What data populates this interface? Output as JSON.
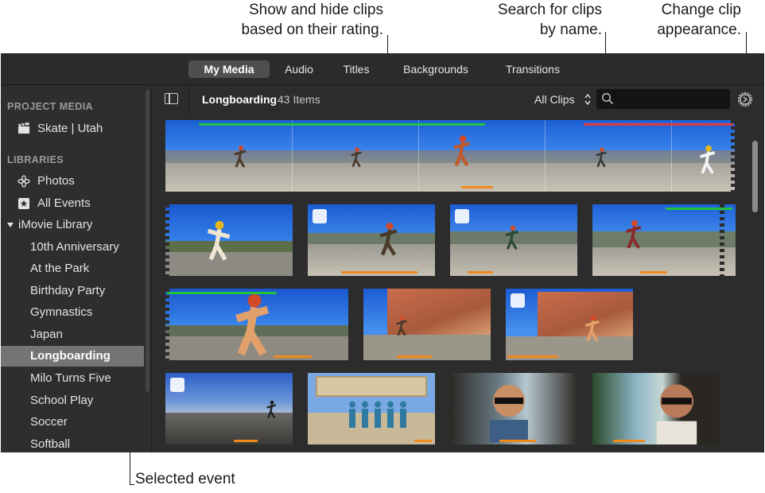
{
  "callouts": {
    "rating": "Show and hide clips\nbased on their rating.",
    "rating_line1": "Show and hide clips",
    "rating_line2": "based on their rating.",
    "search_line1": "Search for clips",
    "search_line2": "by name.",
    "appearance_line1": "Change clip",
    "appearance_line2": "appearance.",
    "selected": "Selected event"
  },
  "tabs": [
    {
      "label": "My Media",
      "active": true
    },
    {
      "label": "Audio",
      "active": false
    },
    {
      "label": "Titles",
      "active": false
    },
    {
      "label": "Backgrounds",
      "active": false
    },
    {
      "label": "Transitions",
      "active": false
    }
  ],
  "sidebar": {
    "project_media_heading": "PROJECT MEDIA",
    "project": {
      "label": "Skate | Utah",
      "icon": "clapperboard-icon"
    },
    "libraries_heading": "LIBRARIES",
    "photos": {
      "label": "Photos",
      "icon": "photos-flower-icon"
    },
    "all_events": {
      "label": "All Events",
      "icon": "star-icon"
    },
    "library": {
      "label": "iMovie Library",
      "icon": "disclosure-triangle-icon"
    },
    "events": [
      {
        "label": "10th Anniversary",
        "selected": false
      },
      {
        "label": "At the Park",
        "selected": false
      },
      {
        "label": "Birthday Party",
        "selected": false
      },
      {
        "label": "Gymnastics",
        "selected": false
      },
      {
        "label": "Japan",
        "selected": false
      },
      {
        "label": "Longboarding",
        "selected": true
      },
      {
        "label": "Milo Turns Five",
        "selected": false
      },
      {
        "label": "School Play",
        "selected": false
      },
      {
        "label": "Soccer",
        "selected": false
      },
      {
        "label": "Softball",
        "selected": false
      }
    ]
  },
  "browser": {
    "event_title": "Longboarding",
    "item_count": "43 Items",
    "filter_label": "All Clips",
    "search_placeholder": ""
  },
  "colors": {
    "favorite": "#22c43c",
    "rejected": "#e03a3a",
    "used": "#f08a1a",
    "selected_row": "#747474"
  }
}
